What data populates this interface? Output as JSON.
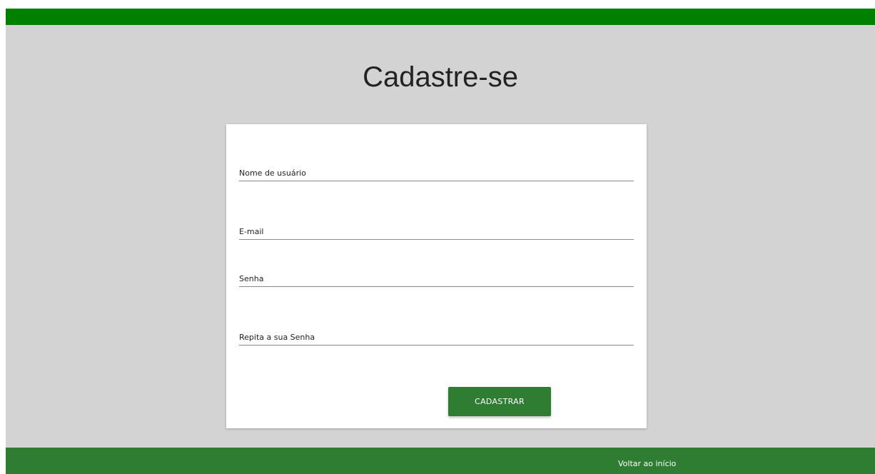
{
  "page": {
    "title": "Cadastre-se"
  },
  "form": {
    "fields": [
      {
        "placeholder": "Nome de usuário",
        "value": ""
      },
      {
        "placeholder": "E-mail",
        "value": ""
      },
      {
        "placeholder": "Senha",
        "value": ""
      },
      {
        "placeholder": "Repita a sua Senha",
        "value": ""
      }
    ],
    "submit_label": "CADASTRAR"
  },
  "footer": {
    "link_label": "Voltar ao início"
  },
  "colors": {
    "top_bar": "#008000",
    "background": "#d3d3d3",
    "button": "#2e7d32",
    "footer": "#2e7d32"
  }
}
